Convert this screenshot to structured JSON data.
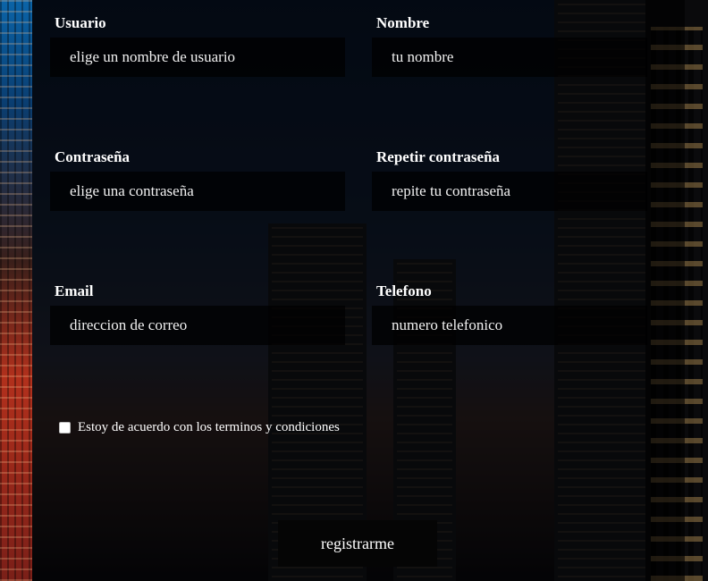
{
  "form": {
    "fields": [
      {
        "label": "Usuario",
        "placeholder": "elige un nombre de usuario"
      },
      {
        "label": "Nombre",
        "placeholder": "tu nombre"
      },
      {
        "label": "Contraseña",
        "placeholder": "elige una contraseña"
      },
      {
        "label": "Repetir contraseña",
        "placeholder": "repite tu contraseña"
      },
      {
        "label": "Email",
        "placeholder": "direccion de correo"
      },
      {
        "label": "Telefono",
        "placeholder": "numero telefonico"
      }
    ],
    "terms_label": "Estoy de acuerdo con los terminos y condiciones",
    "terms_checked": false,
    "submit_label": "registrarme"
  }
}
